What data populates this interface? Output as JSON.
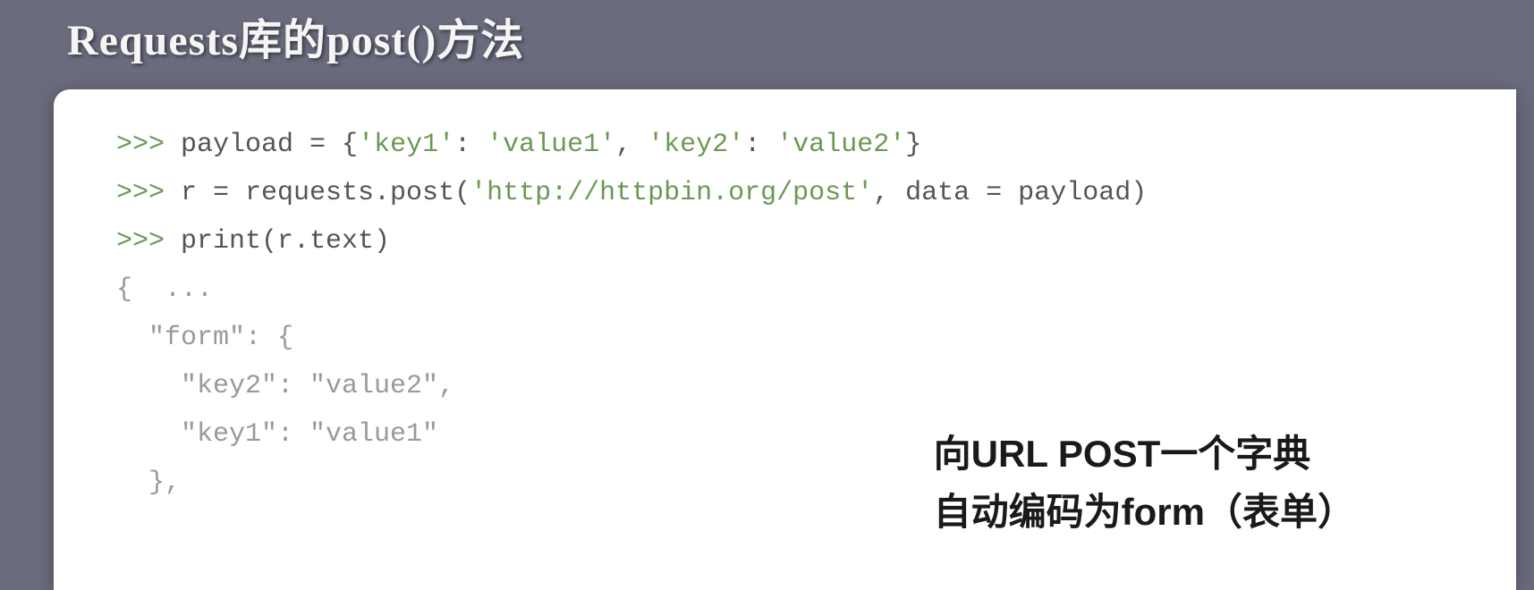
{
  "title": "Requests库的post()方法",
  "code": {
    "line1": {
      "prompt": ">>> ",
      "pre": "payload = {",
      "s1": "'key1'",
      "c1": ": ",
      "s2": "'value1'",
      "c2": ", ",
      "s3": "'key2'",
      "c3": ": ",
      "s4": "'value2'",
      "post": "}"
    },
    "line2": {
      "prompt": ">>> ",
      "pre": "r = requests.post(",
      "url": "'http://httpbin.org/post'",
      "post": ", data = payload)"
    },
    "line3": {
      "prompt": ">>> ",
      "text": "print(r.text)"
    },
    "out1": "{  ...",
    "out2": "  \"form\": {",
    "out3": "    \"key2\": \"value2\",",
    "out4": "    \"key1\": \"value1\"",
    "out5": "  },"
  },
  "annotation": {
    "line1": "向URL POST一个字典",
    "line2": "自动编码为form（表单）"
  }
}
